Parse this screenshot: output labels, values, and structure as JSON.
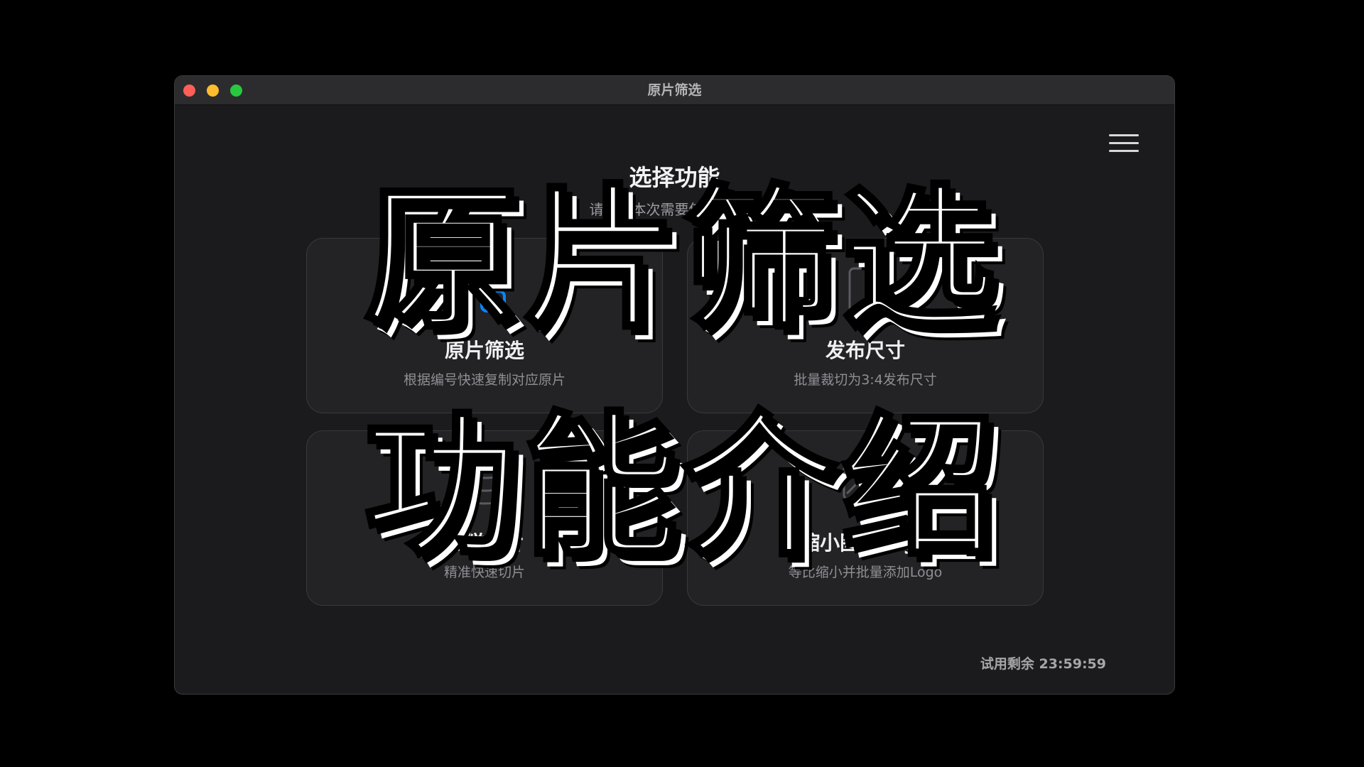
{
  "window": {
    "title": "原片筛选"
  },
  "main": {
    "heading": "选择功能",
    "subheading": "请选择本次需要使用的功能",
    "cards": [
      {
        "title": "原片筛选",
        "desc": "根据编号快速复制对应原片",
        "icon": "copy-icon"
      },
      {
        "title": "发布尺寸",
        "desc": "批量裁切为3:4发布尺寸",
        "icon": "crop-icon"
      },
      {
        "title": "蛋糕切片",
        "desc": "精准快速切片",
        "icon": "cake-slice-icon"
      },
      {
        "title": "缩小图+Logo",
        "desc": "等比缩小并批量添加Logo",
        "icon": "image-logo-icon"
      }
    ],
    "menu_icon": "hamburger-menu-icon"
  },
  "footer": {
    "trial": "试用剩余 23:59:59"
  },
  "overlay": {
    "line1": "原片筛选",
    "line2": "功能介绍"
  },
  "colors": {
    "accent": "#0a84ff",
    "background": "#1b1b1e",
    "card": "#232326"
  }
}
